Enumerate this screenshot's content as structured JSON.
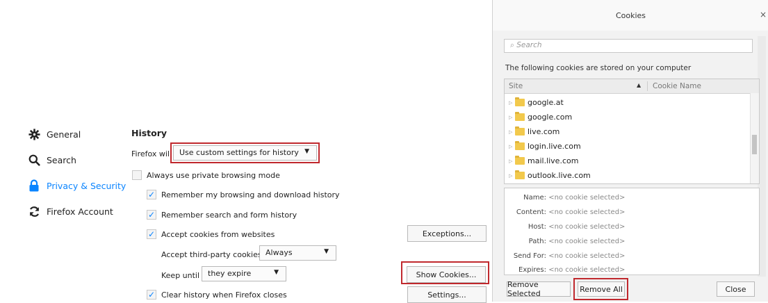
{
  "sidebar": {
    "items": [
      {
        "label": "General",
        "icon": "gear-icon"
      },
      {
        "label": "Search",
        "icon": "search-icon"
      },
      {
        "label": "Privacy & Security",
        "icon": "lock-icon"
      },
      {
        "label": "Firefox Account",
        "icon": "sync-icon"
      }
    ],
    "active_color": "#0a84ff"
  },
  "history": {
    "title": "History",
    "firefox_will_label": "Firefox will",
    "history_mode": "Use custom settings for history",
    "private_mode_label": "Always use private browsing mode",
    "remember_browsing_label": "Remember my browsing and download history",
    "remember_search_label": "Remember search and form history",
    "accept_cookies_label": "Accept cookies from websites",
    "exceptions_button": "Exceptions...",
    "third_party_label": "Accept third-party cookies",
    "third_party_value": "Always",
    "keep_until_label": "Keep until",
    "keep_until_value": "they expire",
    "show_cookies_button": "Show Cookies...",
    "clear_history_label": "Clear history when Firefox closes",
    "settings_button": "Settings..."
  },
  "highlight_color": "#c0282d",
  "cookies_dialog": {
    "title": "Cookies",
    "close_glyph": "×",
    "search_placeholder": "Search",
    "description": "The following cookies are stored on your computer",
    "col_site": "Site",
    "col_cookie_name": "Cookie Name",
    "sites": [
      "google.at",
      "google.com",
      "live.com",
      "login.live.com",
      "mail.live.com",
      "outlook.live.com"
    ],
    "details": {
      "name_label": "Name:",
      "content_label": "Content:",
      "host_label": "Host:",
      "path_label": "Path:",
      "send_for_label": "Send For:",
      "expires_label": "Expires:",
      "empty_value": "<no cookie selected>"
    },
    "remove_selected_button": "Remove Selected",
    "remove_all_button": "Remove All",
    "close_button": "Close"
  }
}
